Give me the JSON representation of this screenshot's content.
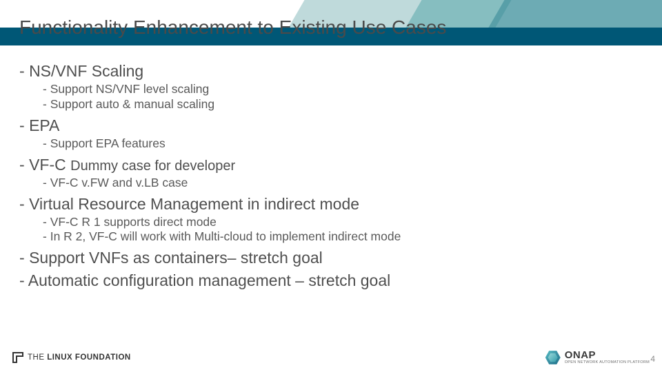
{
  "title": "Functionality Enhancement to Existing Use Cases",
  "bullets": [
    {
      "text": "NS/VNF Scaling",
      "children": [
        {
          "text": "Support  NS/VNF level scaling"
        },
        {
          "text": "Support auto & manual scaling"
        }
      ]
    },
    {
      "text": "EPA",
      "children": [
        {
          "text": "Support EPA features"
        }
      ]
    },
    {
      "text": "VF-C ",
      "text_small": "Dummy case for developer",
      "children": [
        {
          "text": "VF-C v.FW and v.LB case"
        }
      ]
    },
    {
      "text": "Virtual Resource Management in indirect mode",
      "children": [
        {
          "text": "VF-C R 1 supports direct mode"
        },
        {
          "text": "In R 2, VF-C will work with Multi-cloud to implement indirect mode"
        }
      ]
    },
    {
      "text": "Support VNFs as containers– stretch goal",
      "children": []
    },
    {
      "text": "Automatic configuration management – stretch goal",
      "children": []
    }
  ],
  "footer": {
    "linux_foundation_prefix": "THE",
    "linux_foundation_main": "LINUX FOUNDATION",
    "onap_name": "ONAP",
    "onap_sub": "OPEN NETWORK AUTOMATION PLATFORM"
  },
  "page_number": "4"
}
